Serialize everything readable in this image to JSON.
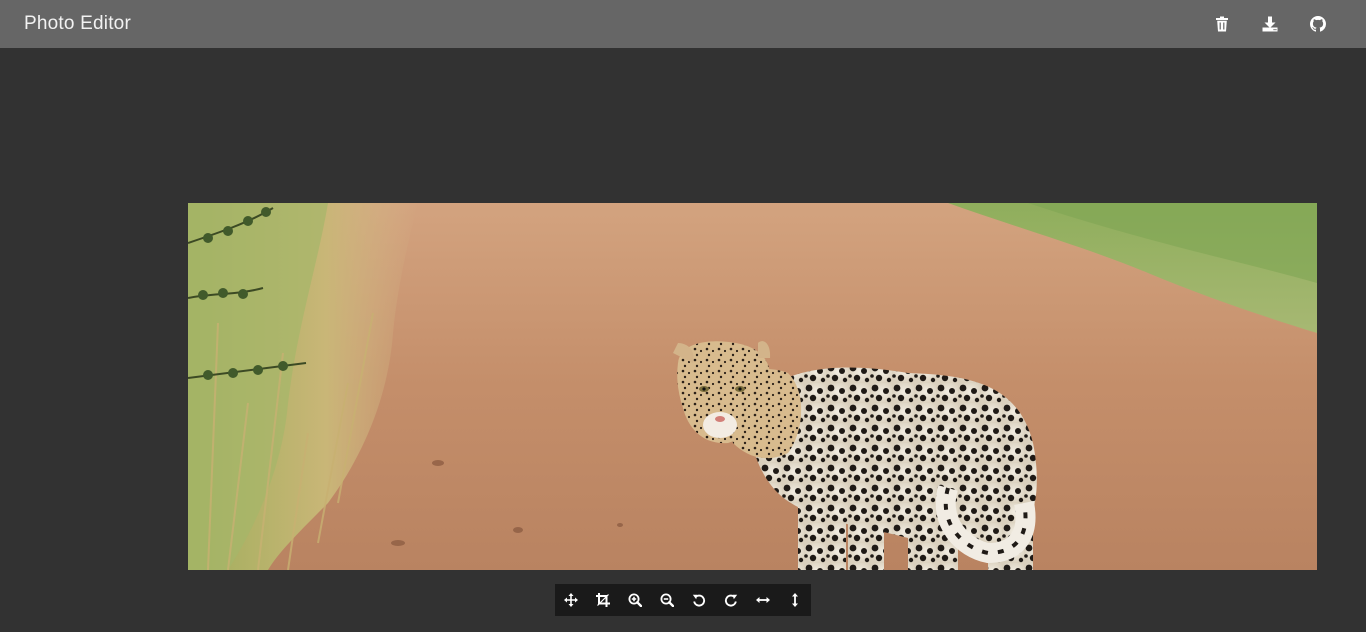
{
  "app": {
    "title": "Photo Editor"
  },
  "header": {
    "actions": [
      {
        "name": "delete",
        "icon": "trash-icon"
      },
      {
        "name": "download",
        "icon": "download-icon"
      },
      {
        "name": "github",
        "icon": "github-icon"
      }
    ]
  },
  "toolbar": {
    "tools": [
      {
        "name": "move",
        "icon": "move-icon"
      },
      {
        "name": "crop",
        "icon": "crop-icon"
      },
      {
        "name": "zoom-in",
        "icon": "zoom-in-icon"
      },
      {
        "name": "zoom-out",
        "icon": "zoom-out-icon"
      },
      {
        "name": "rotate-left",
        "icon": "rotate-left-icon"
      },
      {
        "name": "rotate-right",
        "icon": "rotate-right-icon"
      },
      {
        "name": "flip-horizontal",
        "icon": "flip-horizontal-icon"
      },
      {
        "name": "flip-vertical",
        "icon": "flip-vertical-icon"
      }
    ]
  },
  "photo": {
    "subject": "leopard-on-dirt-road"
  },
  "colors": {
    "header_bg": "#666666",
    "canvas_bg": "#323232",
    "toolbar_bg": "#1a1a1a",
    "icon_fg": "#ffffff"
  }
}
